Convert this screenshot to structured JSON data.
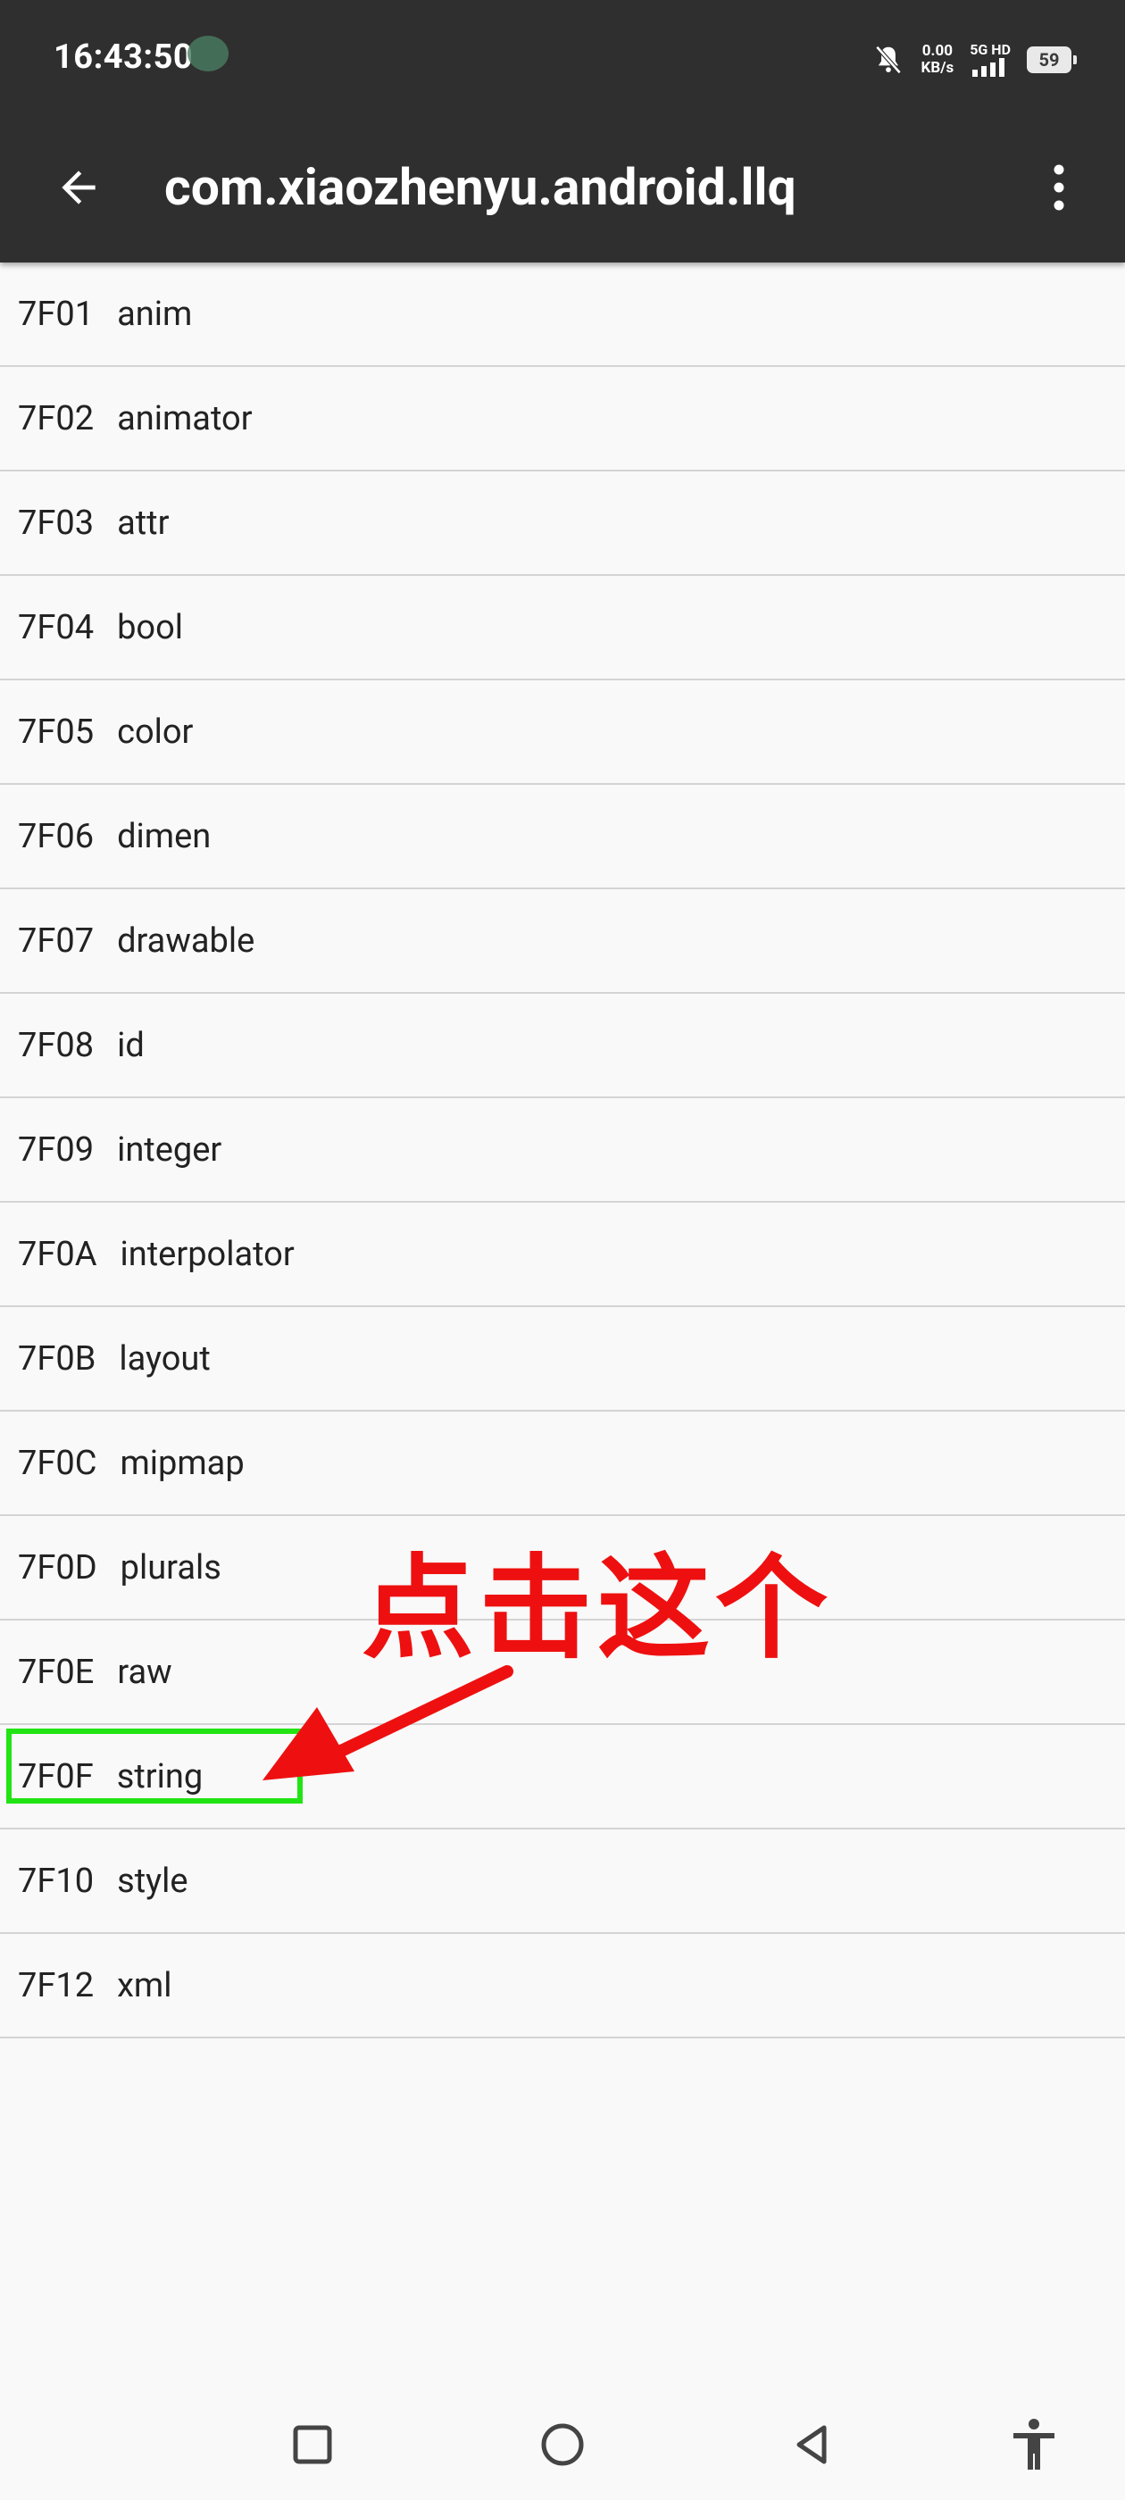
{
  "status_bar": {
    "time": "16:43:50",
    "net_speed_value": "0.00",
    "net_speed_unit": "KB/s",
    "network_label": "5G HD",
    "battery": "59"
  },
  "app_bar": {
    "title": "com.xiaozhenyu.android.llq",
    "back_icon": "arrow-left-icon",
    "menu_icon": "more-vertical-icon"
  },
  "resource_types": [
    {
      "code": "7F01",
      "name": "anim"
    },
    {
      "code": "7F02",
      "name": "animator"
    },
    {
      "code": "7F03",
      "name": "attr"
    },
    {
      "code": "7F04",
      "name": "bool"
    },
    {
      "code": "7F05",
      "name": "color"
    },
    {
      "code": "7F06",
      "name": "dimen"
    },
    {
      "code": "7F07",
      "name": "drawable"
    },
    {
      "code": "7F08",
      "name": "id"
    },
    {
      "code": "7F09",
      "name": "integer"
    },
    {
      "code": "7F0A",
      "name": "interpolator"
    },
    {
      "code": "7F0B",
      "name": "layout"
    },
    {
      "code": "7F0C",
      "name": "mipmap"
    },
    {
      "code": "7F0D",
      "name": "plurals"
    },
    {
      "code": "7F0E",
      "name": "raw"
    },
    {
      "code": "7F0F",
      "name": "string"
    },
    {
      "code": "7F10",
      "name": "style"
    },
    {
      "code": "7F12",
      "name": "xml"
    }
  ],
  "annotation": {
    "text": "点击这个",
    "color": "#ee1010",
    "highlight_color": "#22e414"
  },
  "nav_bar": {
    "icons": [
      "square-recents-icon",
      "circle-home-icon",
      "triangle-back-icon",
      "accessibility-icon"
    ]
  }
}
